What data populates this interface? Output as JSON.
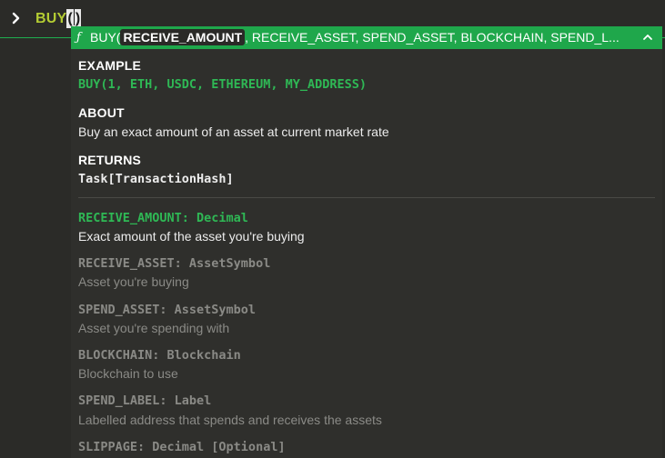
{
  "input": {
    "text": "BUY",
    "parens": "()"
  },
  "signature": {
    "prefix": "BUY(",
    "active_param": "RECEIVE_AMOUNT",
    "rest": ", RECEIVE_ASSET, SPEND_ASSET, BLOCKCHAIN, SPEND_L..."
  },
  "example": {
    "label": "EXAMPLE",
    "code": "BUY(1, ETH, USDC, ETHEREUM, MY_ADDRESS)"
  },
  "about": {
    "label": "ABOUT",
    "text": "Buy an exact amount of an asset at current market rate"
  },
  "returns": {
    "label": "RETURNS",
    "type": "Task[TransactionHash]"
  },
  "params": [
    {
      "name": "RECEIVE_AMOUNT: Decimal",
      "desc": "Exact amount of the asset you're buying"
    },
    {
      "name": "RECEIVE_ASSET: AssetSymbol",
      "desc": "Asset you're buying"
    },
    {
      "name": "SPEND_ASSET: AssetSymbol",
      "desc": "Asset you're spending with"
    },
    {
      "name": "BLOCKCHAIN: Blockchain",
      "desc": "Blockchain to use"
    },
    {
      "name": "SPEND_LABEL: Label",
      "desc": "Labelled address that spends and receives the assets"
    },
    {
      "name": "SLIPPAGE: Decimal [Optional]",
      "desc": ""
    }
  ],
  "colors": {
    "accent": "#1fa74b",
    "input_text": "#b4cc33",
    "active_param": "#2fb855",
    "inactive_param": "#8a8a86",
    "background": "#2b2b28"
  },
  "icons": {
    "prompt": "chevron-right-icon",
    "function": "function-icon",
    "collapse": "chevron-up-icon"
  }
}
